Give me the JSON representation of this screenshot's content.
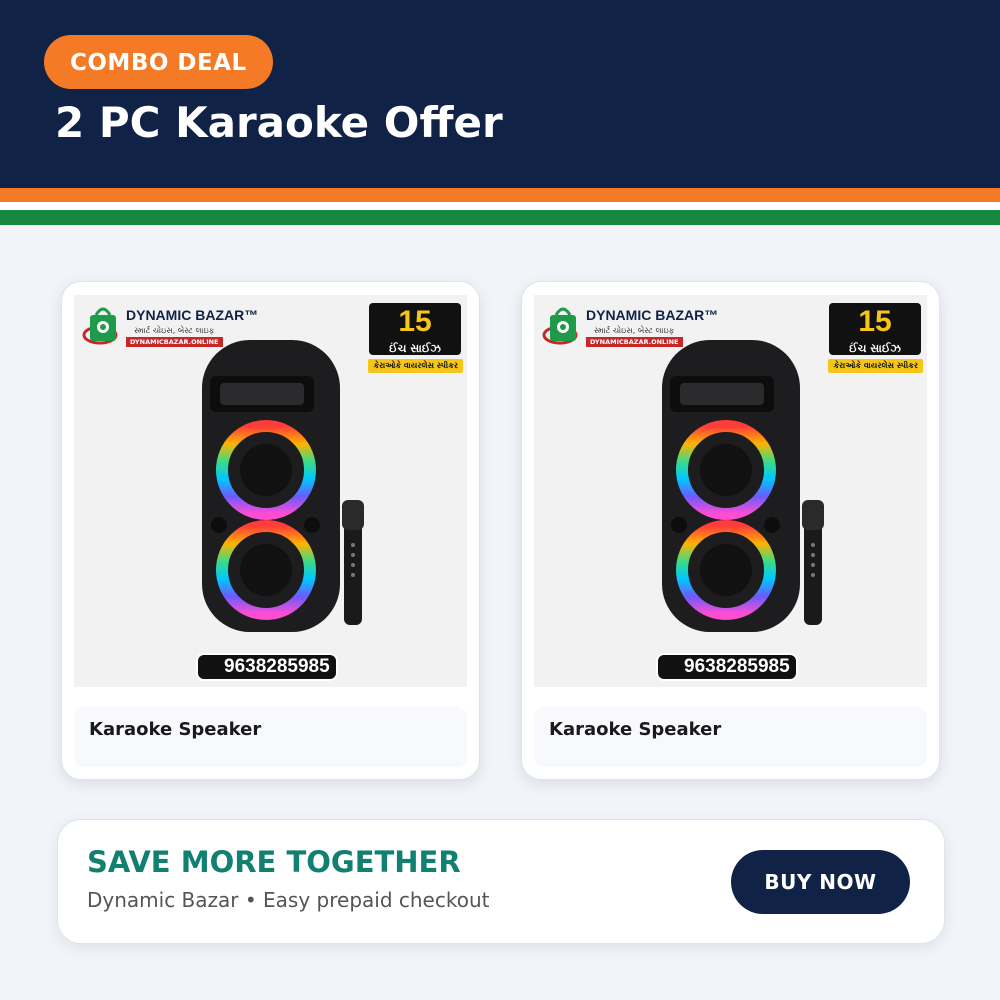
{
  "header": {
    "badge": "COMBO DEAL",
    "title": "2 PC Karaoke Offer"
  },
  "colors": {
    "navy": "#102346",
    "orange": "#f47a26",
    "green": "#17883f",
    "teal": "#118070"
  },
  "products": [
    {
      "label": "Karaoke Speaker",
      "image": {
        "brand": "DYNAMIC BAZAR",
        "brand_highlight": "BAZAR",
        "tm": "™",
        "tagline": "સ્માર્ટ ચોઇસ, બેસ્ટ લાઇફ",
        "url": "DYNAMICBAZAR.ONLINE",
        "size_number": "15",
        "size_text": "ઈંચ સાઈઝ",
        "size_sub": "કેરાઓકે વાયરલેસ સ્પીકર",
        "phone": "9638285985"
      }
    },
    {
      "label": "Karaoke Speaker",
      "image": {
        "brand": "DYNAMIC BAZAR",
        "brand_highlight": "BAZAR",
        "tm": "™",
        "tagline": "સ્માર્ટ ચોઇસ, બેસ્ટ લાઇફ",
        "url": "DYNAMICBAZAR.ONLINE",
        "size_number": "15",
        "size_text": "ઈંચ સાઈઝ",
        "size_sub": "કેરાઓકે વાયરલેસ સ્પીકર",
        "phone": "9638285985"
      }
    }
  ],
  "cta": {
    "heading": "SAVE MORE TOGETHER",
    "subtext": "Dynamic Bazar • Easy prepaid checkout",
    "button": "BUY NOW"
  }
}
